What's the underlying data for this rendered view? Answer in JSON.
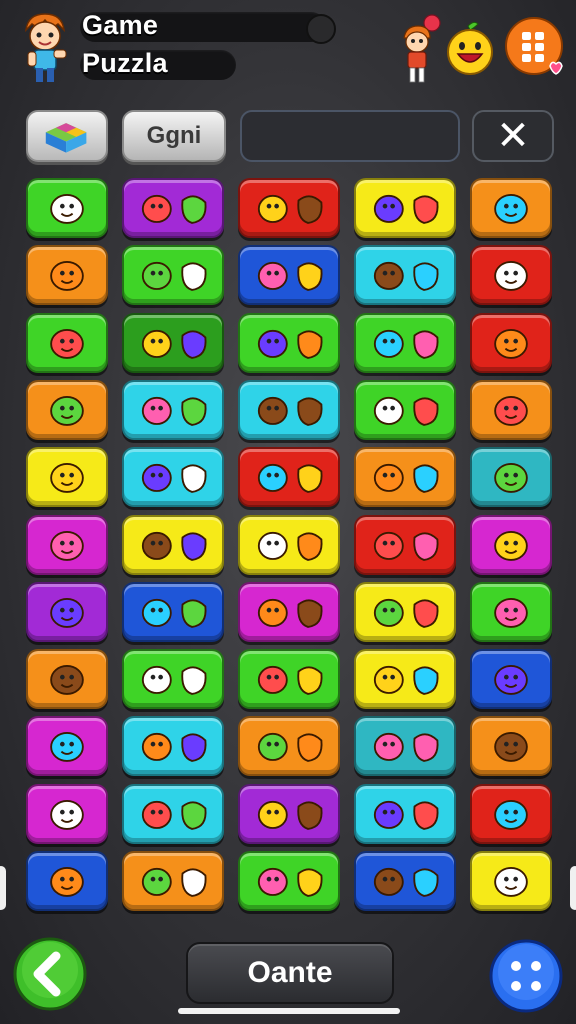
{
  "header": {
    "title_line1": "Game",
    "title_line2": "Puzzla"
  },
  "toolbar": {
    "label_button": "Ggni",
    "search_placeholder": "",
    "close_symbol": "✕"
  },
  "bottom": {
    "action_label": "Oante"
  },
  "colors": {
    "background": "#333337",
    "green": "#3fd427",
    "purple": "#a22ad6",
    "red": "#e0231a",
    "yellow": "#f6ea18",
    "orange": "#f5901a",
    "cyan": "#2fd3e8",
    "blue": "#1f56d8",
    "magenta": "#d627d0",
    "dark_green": "#2c9e1e",
    "teal": "#2fb7c2"
  },
  "grid": {
    "rows": [
      [
        {
          "color": "green",
          "icon": "green-monster-icon"
        },
        {
          "color": "purple",
          "icon": "red-monster-eye-icon"
        },
        {
          "color": "red",
          "icon": "bean-pod-icon"
        },
        {
          "color": "yellow",
          "icon": "spiky-ball-icon"
        },
        {
          "color": "orange",
          "icon": "dice-cube-icon"
        }
      ],
      [
        {
          "color": "orange",
          "icon": "cartoon-dog-icon"
        },
        {
          "color": "green",
          "icon": "creatures-pair-icon"
        },
        {
          "color": "blue",
          "icon": "heart-and-cookie-icon"
        },
        {
          "color": "cyan",
          "icon": "candy-bar-icon"
        },
        {
          "color": "red",
          "icon": "purple-block-icon"
        }
      ],
      [
        {
          "color": "green",
          "icon": "orange-fish-icon"
        },
        {
          "color": "dark_green",
          "icon": "berries-and-cracker-icon"
        },
        {
          "color": "green",
          "icon": "croissant-and-cookie-icon"
        },
        {
          "color": "green",
          "icon": "fruit-and-blocks-icon"
        },
        {
          "color": "red",
          "icon": "purple-ring-icon"
        }
      ],
      [
        {
          "color": "orange",
          "icon": "green-bottle-icon"
        },
        {
          "color": "cyan",
          "icon": "green-cloud-icon"
        },
        {
          "color": "cyan",
          "icon": "blue-balloon-and-heart-icon"
        },
        {
          "color": "green",
          "icon": "cauldron-and-candy-icon"
        },
        {
          "color": "orange",
          "icon": "orange-fruit-icon"
        }
      ],
      [
        {
          "color": "yellow",
          "icon": "blue-crayon-icon"
        },
        {
          "color": "cyan",
          "icon": "green-blob-icon"
        },
        {
          "color": "red",
          "icon": "yellow-ball-and-horn-icon"
        },
        {
          "color": "orange",
          "icon": "pink-slab-icon"
        },
        {
          "color": "teal",
          "icon": "pink-cup-icon"
        }
      ],
      [
        {
          "color": "magenta",
          "icon": "camera-block-icon"
        },
        {
          "color": "yellow",
          "icon": "lantern-and-pepper-icon"
        },
        {
          "color": "yellow",
          "icon": "white-gadget-icon"
        },
        {
          "color": "red",
          "icon": "blue-flag-block-icon"
        },
        {
          "color": "magenta",
          "icon": "orange-crate-icon"
        }
      ],
      [
        {
          "color": "purple",
          "icon": "blue-keyboard-icon"
        },
        {
          "color": "blue",
          "icon": "comet-icon"
        },
        {
          "color": "magenta",
          "icon": "white-ghosts-icon"
        },
        {
          "color": "yellow",
          "icon": "pink-grapes-icon"
        },
        {
          "color": "green",
          "icon": "yellow-banana-icon"
        }
      ],
      [
        {
          "color": "orange",
          "icon": "green-cyclops-icon"
        },
        {
          "color": "green",
          "icon": "gingerbread-pair-icon"
        },
        {
          "color": "green",
          "icon": "leaf-and-heart-icon"
        },
        {
          "color": "yellow",
          "icon": "red-controller-icon"
        },
        {
          "color": "blue",
          "icon": "purple-face-icon"
        }
      ],
      [
        {
          "color": "magenta",
          "icon": "red-rose-icon"
        },
        {
          "color": "cyan",
          "icon": "orange-creature-icon"
        },
        {
          "color": "orange",
          "icon": "fish-and-orb-icon"
        },
        {
          "color": "teal",
          "icon": "green-leaf-icon"
        },
        {
          "color": "orange",
          "icon": "red-cup-icon"
        }
      ],
      [
        {
          "color": "magenta",
          "icon": "mushroom-hammer-icon"
        },
        {
          "color": "cyan",
          "icon": "cookie-and-cone-icon"
        },
        {
          "color": "purple",
          "icon": "masks-icon"
        },
        {
          "color": "cyan",
          "icon": "pumpkin-and-card-icon"
        },
        {
          "color": "red",
          "icon": "table-icon"
        }
      ],
      [
        {
          "color": "blue",
          "icon": "pencil-tip-icon"
        },
        {
          "color": "orange",
          "icon": "cup-and-palm-icon"
        },
        {
          "color": "green",
          "icon": "two-faces-icon"
        },
        {
          "color": "blue",
          "icon": "orange-lollipop-icon"
        },
        {
          "color": "yellow",
          "icon": "yellow-critter-icon"
        }
      ]
    ]
  }
}
